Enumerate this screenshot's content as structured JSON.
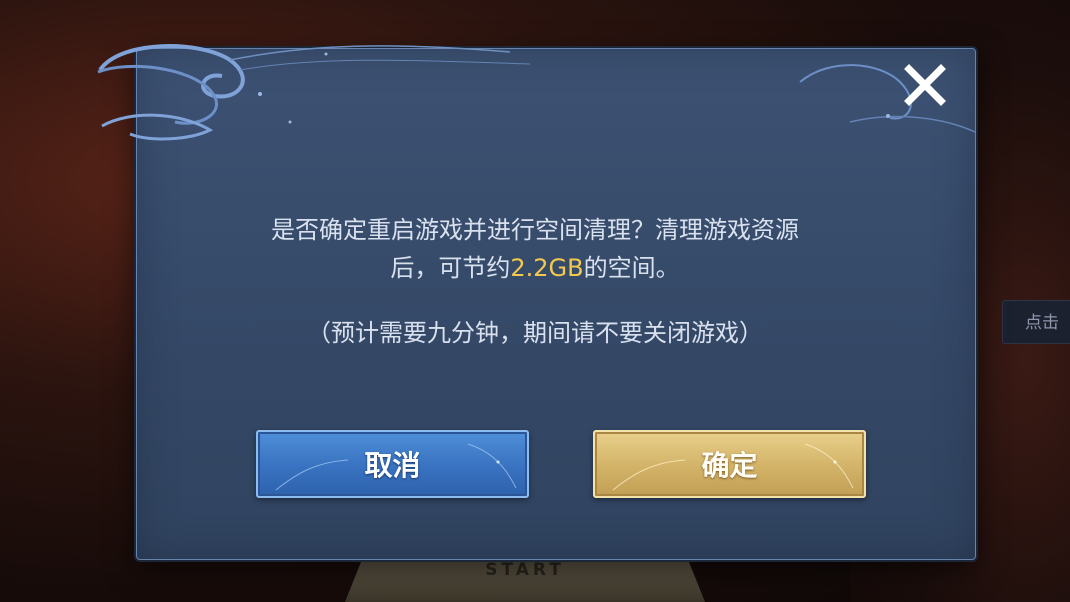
{
  "dialog": {
    "message_line1": "是否确定重启游戏并进行空间清理？清理游戏资源",
    "message_line2_prefix": "后，可节约",
    "message_highlight": "2.2GB",
    "message_line2_suffix": "的空间。",
    "message_note": "（预计需要九分钟，期间请不要关闭游戏）",
    "cancel_label": "取消",
    "confirm_label": "确定",
    "close_icon": "close-x-icon"
  },
  "background": {
    "hint_text": "点击",
    "start_text": "START"
  },
  "colors": {
    "panel": "#364a69",
    "highlight": "#f2c94c",
    "cancel_button": "#3a74c2",
    "confirm_button": "#d4b56a"
  }
}
